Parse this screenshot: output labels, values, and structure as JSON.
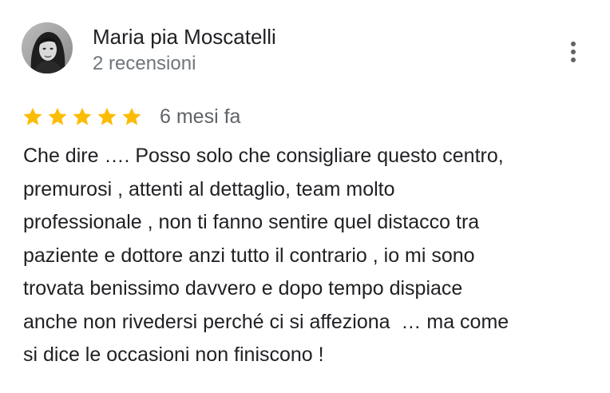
{
  "review": {
    "author_name": "Maria pia Moscatelli",
    "author_reviews": "2 recensioni",
    "rating": 5,
    "rating_max": 5,
    "time": "6 mesi fa",
    "text_lines": [
      "Che dire …. Posso solo che consigliare questo centro,",
      "premurosi , attenti al dettaglio, team molto",
      "professionale , non ti fanno sentire quel distacco tra",
      "paziente e dottore anzi tutto il contrario , io mi sono",
      "trovata benissimo davvero e dopo tempo dispiace",
      "anche non rivedersi perché ci si affeziona  … ma come",
      "si dice le occasioni non finiscono !"
    ],
    "star_color": "#fbbc04",
    "icons": {
      "avatar": "user-photo",
      "star": "star-icon",
      "menu": "more-vert-icon"
    }
  }
}
